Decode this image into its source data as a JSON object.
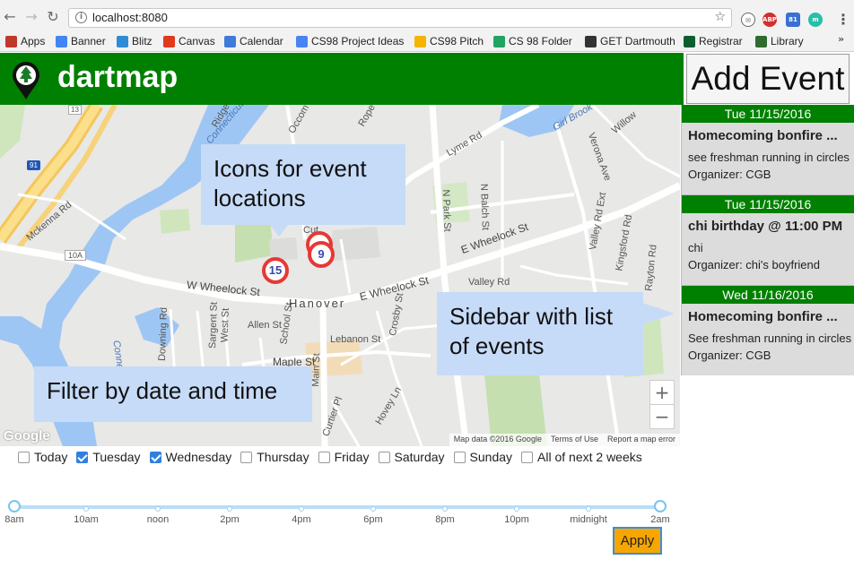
{
  "browser": {
    "url": "localhost:8080",
    "extensions": [
      "ABP",
      "81"
    ],
    "bookmarks": [
      {
        "label": "Apps",
        "icon": "apps-grid-icon",
        "color": "#c0392b"
      },
      {
        "label": "Banner",
        "icon": "google-icon",
        "color": "#4285f4"
      },
      {
        "label": "Blitz",
        "icon": "windows-icon",
        "color": "#2e8bd8"
      },
      {
        "label": "Canvas",
        "icon": "canvas-icon",
        "color": "#e0391c"
      },
      {
        "label": "Calendar",
        "icon": "calendar-icon",
        "color": "#3f7bd9"
      },
      {
        "label": "CS98 Project Ideas",
        "icon": "docs-icon",
        "color": "#4a84f2"
      },
      {
        "label": "CS98 Pitch",
        "icon": "slides-icon",
        "color": "#f4b400"
      },
      {
        "label": "CS 98 Folder",
        "icon": "drive-icon",
        "color": "#1fa463"
      },
      {
        "label": "GET Dartmouth",
        "icon": "get-icon",
        "color": "#333333"
      },
      {
        "label": "Registrar",
        "icon": "registrar-icon",
        "color": "#0b5e2e"
      },
      {
        "label": "Library",
        "icon": "library-icon",
        "color": "#2f6b2f"
      }
    ],
    "more": "»"
  },
  "header": {
    "brand": "dartmap",
    "add_event": "Add Event",
    "color": "#008000"
  },
  "map": {
    "road_labels": [
      "W Wheelock St",
      "E Wheelock St",
      "E Wheelock St",
      "Lyme Rd",
      "N Park St",
      "N Balch St",
      "Valley Rd",
      "Maple St",
      "Main St",
      "Lebanon St",
      "School St",
      "Allen St",
      "Sargent St",
      "West St",
      "Downing Rd",
      "Crosby St",
      "Curtier Pl",
      "Hovey Ln",
      "Mckenna Rd",
      "Rope",
      "Verona Ave",
      "Valley Rd Ext",
      "Kingsford Rd",
      "Rayton Rd",
      "Willow",
      "Girl Brook",
      "Connecticut",
      "Connecticut River",
      "Ridge",
      "Occom",
      "Hanover",
      "10A",
      "91",
      "13",
      "Cut"
    ],
    "markers": [
      {
        "count": "15"
      },
      {
        "count": "9"
      }
    ],
    "zoom_in": "+",
    "zoom_out": "−",
    "google": "Google",
    "footer": [
      "Map data ©2016 Google",
      "Terms of Use",
      "Report a map error"
    ]
  },
  "callouts": {
    "icons": "Icons for event locations",
    "sidebar": "Sidebar with list of events",
    "filter": "Filter by date and time"
  },
  "events": [
    {
      "date": "Tue 11/15/2016",
      "title": "Homecoming bonfire ...",
      "desc": "see freshman running in circles",
      "org": "Organizer: CGB"
    },
    {
      "date": "Tue 11/15/2016",
      "title": "chi birthday @ 11:00 PM",
      "desc": "chi",
      "org": "Organizer: chi's boyfriend"
    },
    {
      "date": "Wed 11/16/2016",
      "title": "Homecoming bonfire ...",
      "desc": "See freshman running in circles",
      "org": "Organizer: CGB"
    }
  ],
  "filters": {
    "days": [
      {
        "label": "Today",
        "checked": false
      },
      {
        "label": "Tuesday",
        "checked": true
      },
      {
        "label": "Wednesday",
        "checked": true
      },
      {
        "label": "Thursday",
        "checked": false
      },
      {
        "label": "Friday",
        "checked": false
      },
      {
        "label": "Saturday",
        "checked": false
      },
      {
        "label": "Sunday",
        "checked": false
      },
      {
        "label": "All of next 2 weeks",
        "checked": false
      }
    ],
    "time_labels": [
      "8am",
      "10am",
      "noon",
      "2pm",
      "4pm",
      "6pm",
      "8pm",
      "10pm",
      "midnight",
      "2am"
    ],
    "range": [
      "8am",
      "2am"
    ],
    "apply": "Apply"
  }
}
